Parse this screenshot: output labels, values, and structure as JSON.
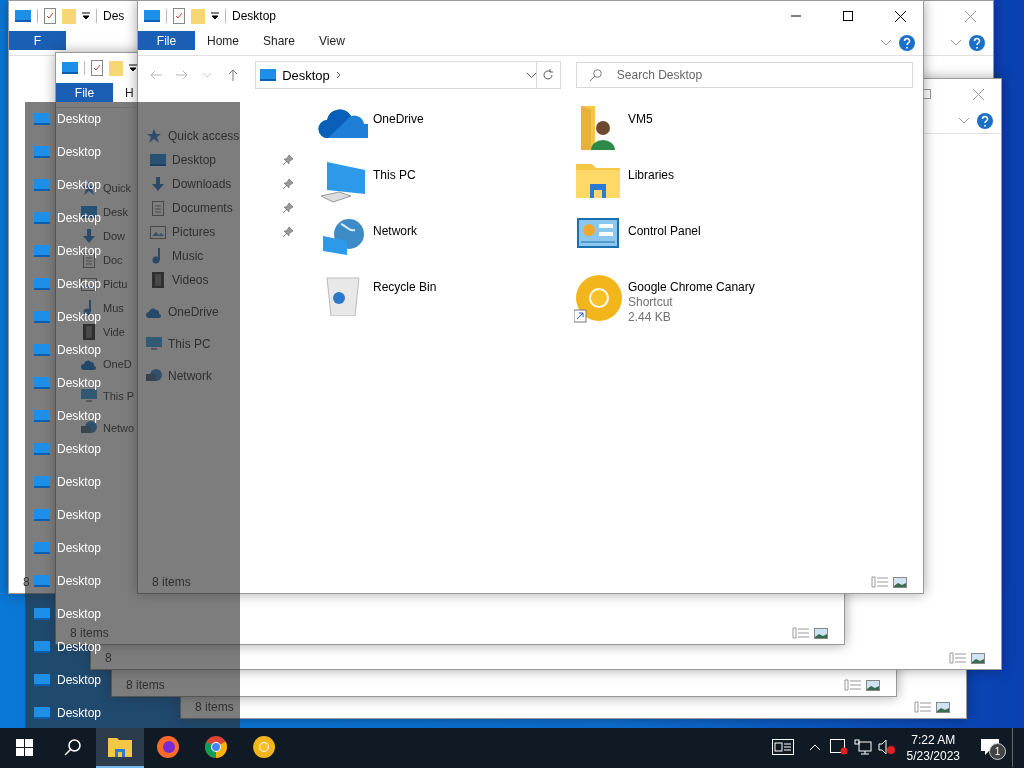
{
  "background_windows": [
    {
      "title": "Des",
      "tabs": [
        {
          "label": "F",
          "selected": true
        }
      ],
      "status": "8"
    },
    {
      "tabs": [
        {
          "label": "File",
          "selected": true
        },
        {
          "label": "H",
          "selected": false
        }
      ],
      "nav": [
        {
          "label": "Quick",
          "kind": "quick",
          "children": [
            {
              "label": "Desk",
              "kind": "desktop"
            },
            {
              "label": "Dow",
              "kind": "downloads"
            },
            {
              "label": "Doc",
              "kind": "documents"
            },
            {
              "label": "Pictu",
              "kind": "pictures"
            },
            {
              "label": "Mus",
              "kind": "music"
            },
            {
              "label": "Vide",
              "kind": "videos"
            }
          ]
        },
        {
          "label": "OneD",
          "kind": "onedrive"
        },
        {
          "label": "This P",
          "kind": "pc"
        },
        {
          "label": "Netwo",
          "kind": "network"
        }
      ],
      "status": "8 items"
    },
    {
      "status": "8"
    },
    {
      "status": "8 items"
    },
    {
      "status": "8 items"
    }
  ],
  "window": {
    "title": "Desktop",
    "tabs": [
      {
        "label": "File",
        "selected": true
      },
      {
        "label": "Home",
        "selected": false
      },
      {
        "label": "Share",
        "selected": false
      },
      {
        "label": "View",
        "selected": false
      }
    ],
    "address": "Desktop",
    "search": {
      "placeholder": "Search Desktop"
    },
    "nav": [
      {
        "label": "Quick access",
        "kind": "quick",
        "children": [
          {
            "label": "Desktop",
            "kind": "desktop",
            "pinned": true
          },
          {
            "label": "Downloads",
            "kind": "downloads",
            "pinned": true
          },
          {
            "label": "Documents",
            "kind": "documents",
            "pinned": true
          },
          {
            "label": "Pictures",
            "kind": "pictures",
            "pinned": true
          },
          {
            "label": "Music",
            "kind": "music",
            "pinned": false
          },
          {
            "label": "Videos",
            "kind": "videos",
            "pinned": false
          }
        ]
      },
      {
        "label": "OneDrive",
        "kind": "onedrive"
      },
      {
        "label": "This PC",
        "kind": "pc"
      },
      {
        "label": "Network",
        "kind": "network"
      }
    ],
    "items": [
      {
        "name": "OneDrive",
        "kind": "onedrive"
      },
      {
        "name": "VM5",
        "kind": "user-folder"
      },
      {
        "name": "This PC",
        "kind": "pc"
      },
      {
        "name": "Libraries",
        "kind": "libraries"
      },
      {
        "name": "Network",
        "kind": "network"
      },
      {
        "name": "Control Panel",
        "kind": "control-panel"
      },
      {
        "name": "Recycle Bin",
        "kind": "recycle-bin"
      },
      {
        "name": "Google Chrome Canary",
        "kind": "canary",
        "details": [
          "Shortcut",
          "2.44 KB"
        ]
      }
    ],
    "status": "8 items"
  },
  "jump_list": {
    "items": [
      "Desktop",
      "Desktop",
      "Desktop",
      "Desktop",
      "Desktop",
      "Desktop",
      "Desktop",
      "Desktop",
      "Desktop",
      "Desktop",
      "Desktop",
      "Desktop",
      "Desktop",
      "Desktop",
      "Desktop",
      "Desktop",
      "Desktop",
      "Desktop",
      "Desktop"
    ]
  },
  "taskbar": {
    "apps": [
      {
        "kind": "explorer",
        "selected": true
      },
      {
        "kind": "firefox",
        "selected": false
      },
      {
        "kind": "chrome",
        "selected": false
      },
      {
        "kind": "canary",
        "selected": false
      }
    ],
    "clock": {
      "time": "7:22 AM",
      "date": "5/23/2023"
    },
    "notifications": "1"
  }
}
